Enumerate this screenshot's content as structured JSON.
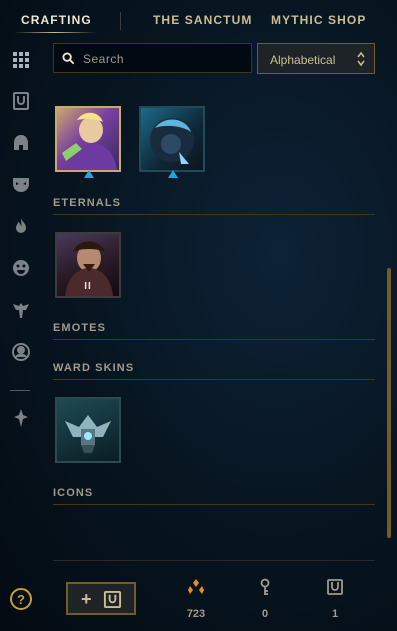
{
  "nav": {
    "tabs": [
      {
        "label": "CRAFTING",
        "active": true
      },
      {
        "label": "THE SANCTUM",
        "active": false
      },
      {
        "label": "MYTHIC SHOP",
        "active": false
      }
    ]
  },
  "sidebar": {
    "items": [
      {
        "name": "grid-icon"
      },
      {
        "name": "chest-icon"
      },
      {
        "name": "helmet-icon"
      },
      {
        "name": "mask-icon"
      },
      {
        "name": "flame-icon"
      },
      {
        "name": "emote-face-icon"
      },
      {
        "name": "ward-icon"
      },
      {
        "name": "profile-icon"
      },
      {
        "name": "disenchant-icon"
      }
    ]
  },
  "search": {
    "placeholder": "Search",
    "value": ""
  },
  "sort": {
    "selected": "Alphabetical"
  },
  "sections": [
    {
      "title": "ETERNALS"
    },
    {
      "title": "EMOTES"
    },
    {
      "title": "WARD SKINS"
    },
    {
      "title": "ICONS"
    }
  ],
  "eternal_tile": {
    "tier": "II"
  },
  "currencies": [
    {
      "name": "orange-essence-icon",
      "value": "723"
    },
    {
      "name": "key-icon",
      "value": "0"
    },
    {
      "name": "chest-icon",
      "value": "1"
    }
  ],
  "help": {
    "label": "?"
  },
  "add_button": {
    "label": "+"
  },
  "colors": {
    "gold": "#c89b3c",
    "gold_light": "#cdbe91",
    "gold_dark": "#785a28",
    "text": "#a09b8c",
    "bg": "#010a13"
  }
}
